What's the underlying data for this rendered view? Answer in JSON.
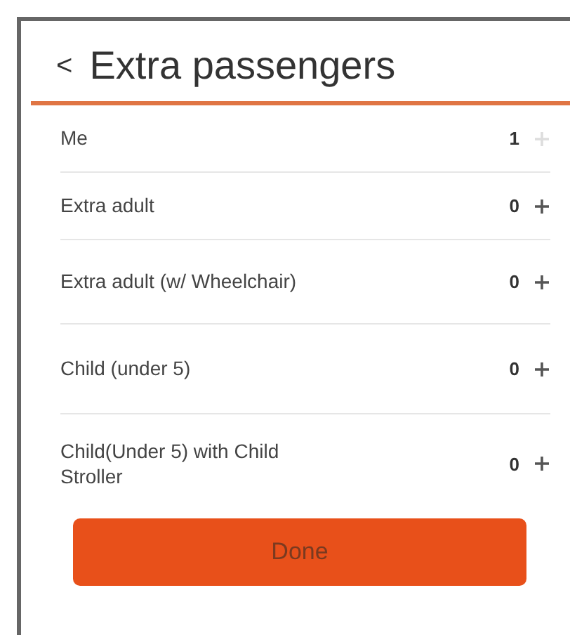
{
  "header": {
    "back": "<",
    "title": "Extra passengers"
  },
  "passengers": [
    {
      "label": "Me",
      "count": "1",
      "disabled": true
    },
    {
      "label": "Extra adult",
      "count": "0",
      "disabled": false
    },
    {
      "label": "Extra adult (w/ Wheelchair)",
      "count": "0",
      "disabled": false
    },
    {
      "label": "Child (under 5)",
      "count": "0",
      "disabled": false
    },
    {
      "label": "Child(Under 5) with Child Stroller",
      "count": "0",
      "disabled": false
    }
  ],
  "button": "Done"
}
